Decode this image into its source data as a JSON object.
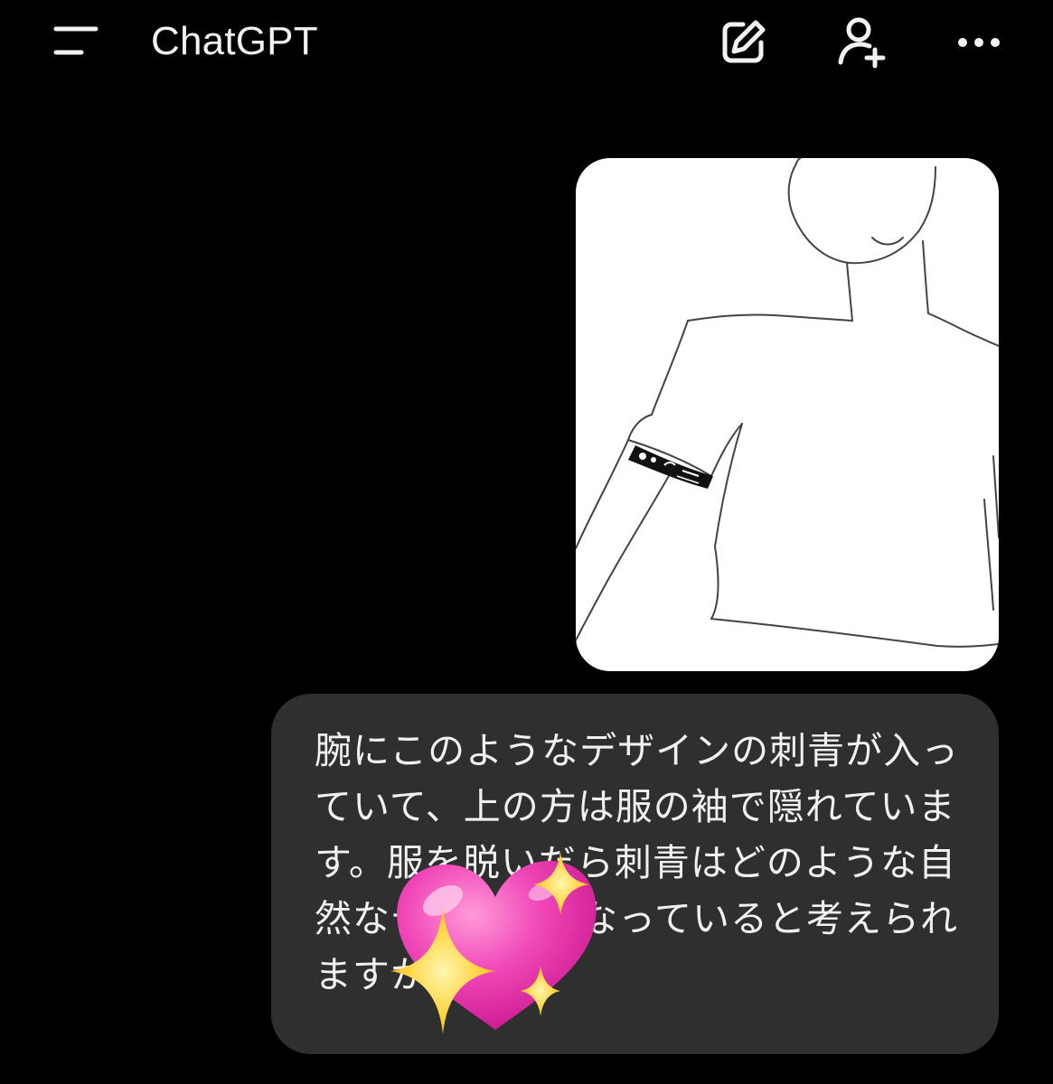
{
  "header": {
    "title": "ChatGPT",
    "icons": {
      "menu": "menu-icon",
      "new_chat": "edit-icon",
      "add_user": "add-user-icon",
      "more": "more-icon"
    }
  },
  "message": {
    "text": "腕にこのようなデザインの刺青が入っていて、上の方は服の袖で隠れています。服を脱いだら刺青はどのような自然なデザインになっていると考えられますか"
  },
  "stickers": {
    "heart": "sparkling-heart-sticker"
  },
  "colors": {
    "background": "#000000",
    "bubble": "#2f2f2f",
    "text": "#f1f1f1",
    "heart": "#f048b8",
    "sparkle": "#ffd23a"
  }
}
